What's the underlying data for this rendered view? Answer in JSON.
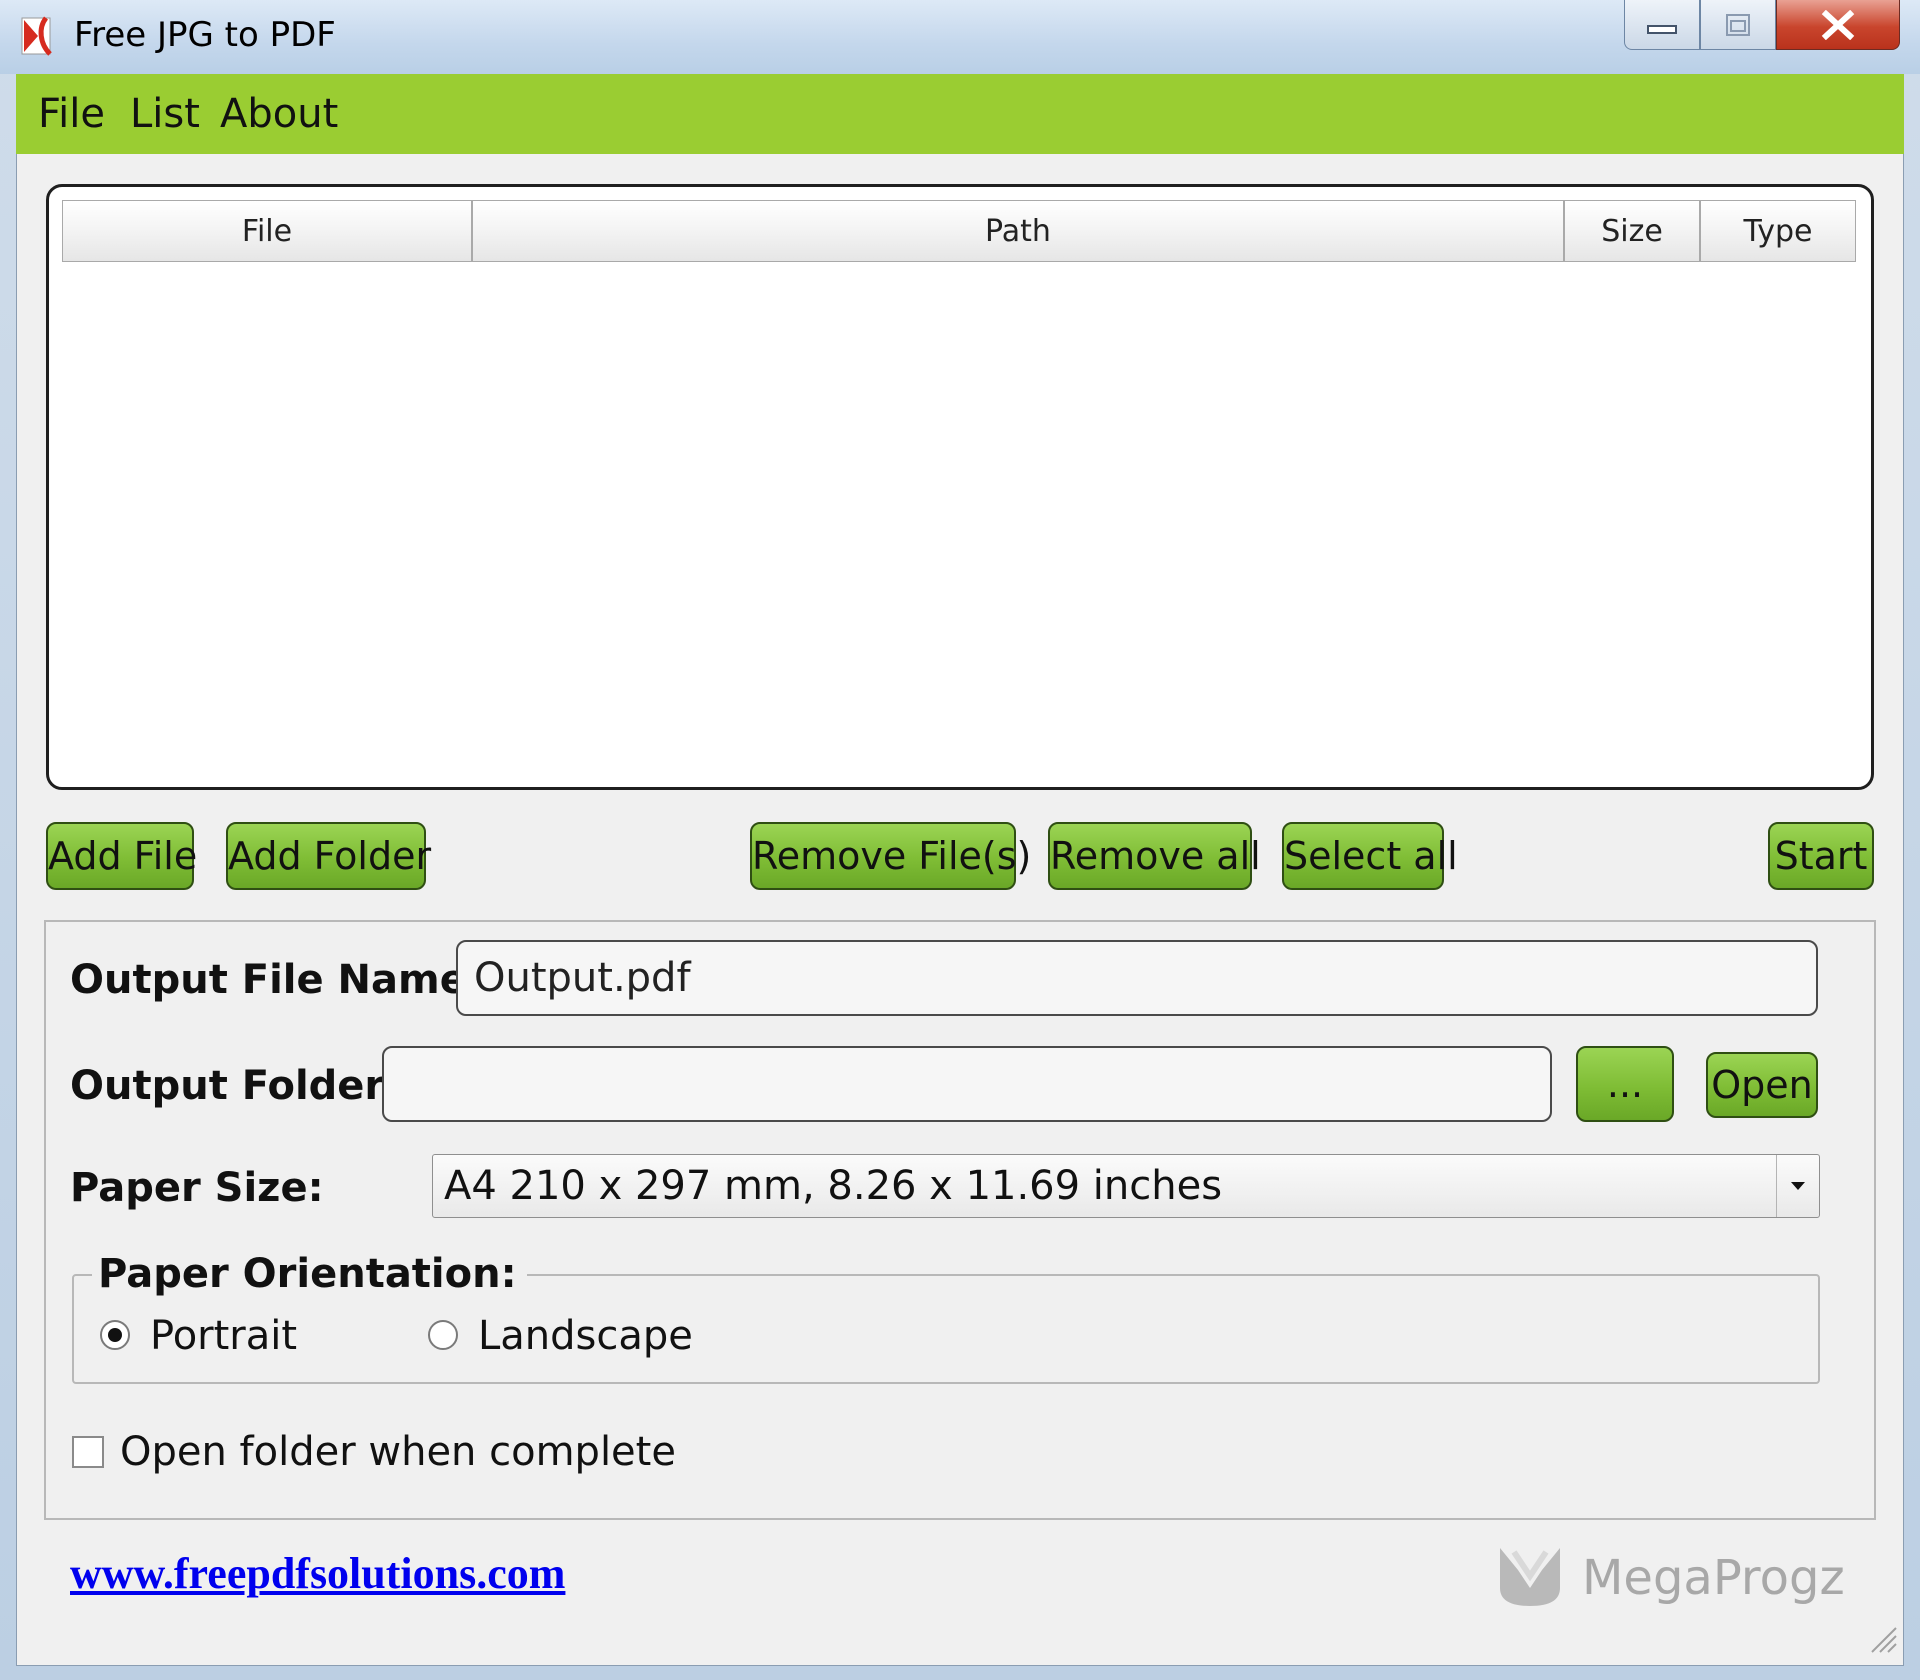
{
  "window": {
    "title": "Free JPG to PDF",
    "icons": {
      "app": "app-logo-icon",
      "minimize": "minimize-icon",
      "maximize": "maximize-icon",
      "close": "close-icon"
    }
  },
  "menu": {
    "file": "File",
    "list": "List",
    "about": "About"
  },
  "file_table": {
    "columns": [
      "File",
      "Path",
      "Size",
      "Type"
    ],
    "rows": []
  },
  "buttons": {
    "add_file": "Add File",
    "add_folder": "Add Folder",
    "remove_files": "Remove File(s)",
    "remove_all": "Remove all",
    "select_all": "Select all",
    "start": "Start",
    "browse": "...",
    "open": "Open"
  },
  "output": {
    "file_name_label": "Output File Name:",
    "file_name_value": "Output.pdf",
    "folder_label": "Output Folder:",
    "folder_value": ""
  },
  "paper": {
    "size_label": "Paper Size:",
    "size_value": "A4 210 x 297 mm, 8.26 x 11.69 inches",
    "orientation_label": "Paper Orientation:",
    "portrait": "Portrait",
    "landscape": "Landscape",
    "selected_orientation": "Portrait"
  },
  "options": {
    "open_folder_when_complete": "Open folder when complete",
    "open_folder_checked": false
  },
  "footer": {
    "link": "www.freepdfsolutions.com",
    "watermark": "MegaProgz"
  },
  "colors": {
    "accent_green": "#9acd32",
    "button_green": "#7fbd35",
    "link_blue": "#0000ee"
  }
}
